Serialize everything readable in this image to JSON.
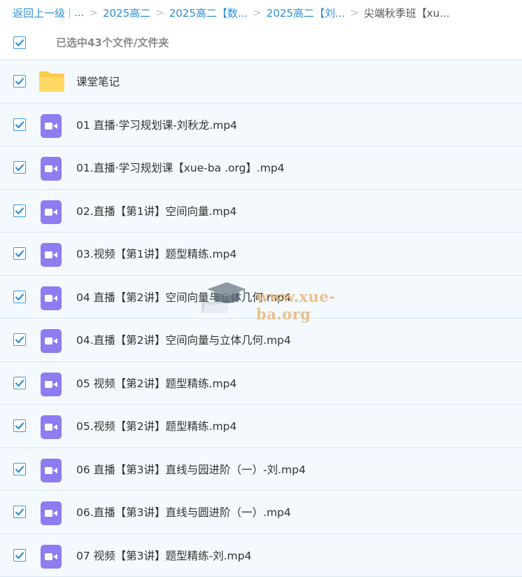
{
  "breadcrumb": {
    "back": "返回上一级",
    "divider": "|",
    "ellipsis": "...",
    "items": [
      "2025高二",
      "2025高二【数...",
      "2025高二【刘...",
      "尖端秋季班【xu..."
    ]
  },
  "selection": {
    "label": "已选中43个文件/文件夹"
  },
  "files": [
    {
      "name": "课堂笔记",
      "type": "folder"
    },
    {
      "name": "01 直播·学习规划课-刘秋龙.mp4",
      "type": "video"
    },
    {
      "name": "01.直播·学习规划课【xue-ba .org】.mp4",
      "type": "video"
    },
    {
      "name": "02.直播【第1讲】空间向量.mp4",
      "type": "video"
    },
    {
      "name": "03.视频【第1讲】题型精练.mp4",
      "type": "video"
    },
    {
      "name": "04 直播【第2讲】空间向量与立体几何.mp4",
      "type": "video"
    },
    {
      "name": "04.直播【第2讲】空间向量与立体几何.mp4",
      "type": "video"
    },
    {
      "name": "05 视频【第2讲】题型精练.mp4",
      "type": "video"
    },
    {
      "name": "05.视频【第2讲】题型精练.mp4",
      "type": "video"
    },
    {
      "name": "06 直播【第3讲】直线与园进阶（一）-刘.mp4",
      "type": "video"
    },
    {
      "name": "06.直播【第3讲】直线与圆进阶（一）.mp4",
      "type": "video"
    },
    {
      "name": "07 视频【第3讲】题型精练-刘.mp4",
      "type": "video"
    }
  ],
  "watermark": {
    "text": "www.xue-ba.org"
  },
  "colors": {
    "accent": "#2e8fd6",
    "row_bg": "#f3f9fd",
    "video_icon": "#8e7cf0",
    "folder_icon": "#ffd257"
  }
}
